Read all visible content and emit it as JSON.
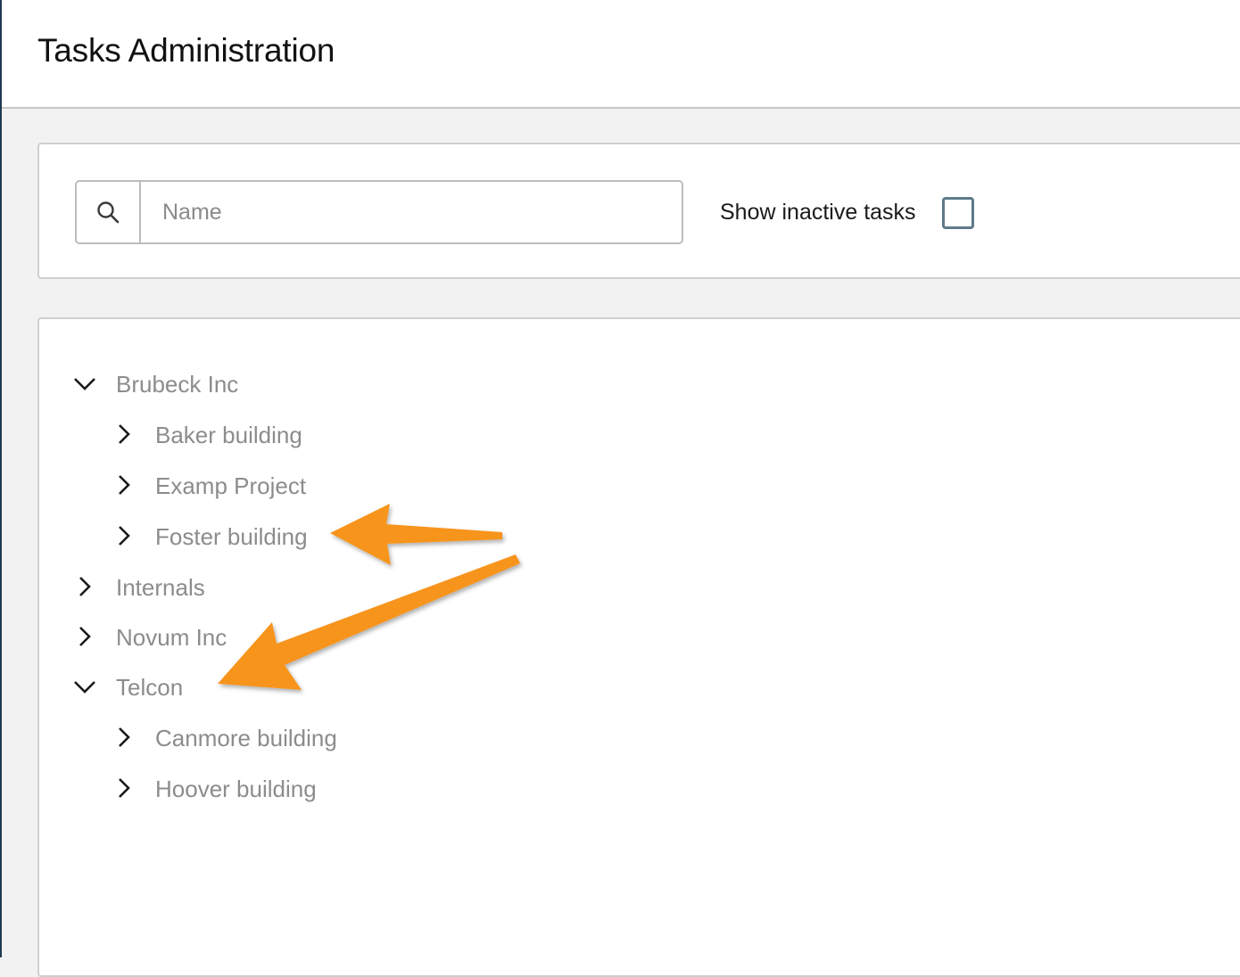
{
  "header": {
    "title": "Tasks Administration"
  },
  "filter": {
    "search_placeholder": "Name",
    "search_value": "",
    "show_inactive_label": "Show inactive tasks",
    "show_inactive_checked": false
  },
  "tree": {
    "nodes": [
      {
        "label": "Brubeck Inc",
        "level": 0,
        "expanded": true
      },
      {
        "label": "Baker building",
        "level": 1,
        "expanded": false
      },
      {
        "label": "Examp Project",
        "level": 1,
        "expanded": false
      },
      {
        "label": "Foster building",
        "level": 1,
        "expanded": false
      },
      {
        "label": "Internals",
        "level": 0,
        "expanded": false
      },
      {
        "label": "Novum Inc",
        "level": 0,
        "expanded": false
      },
      {
        "label": "Telcon",
        "level": 0,
        "expanded": true
      },
      {
        "label": "Canmore building",
        "level": 1,
        "expanded": false
      },
      {
        "label": "Hoover building",
        "level": 1,
        "expanded": false
      }
    ]
  },
  "annotation_color": "#f7941d"
}
